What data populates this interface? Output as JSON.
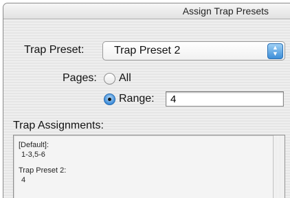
{
  "window": {
    "title": "Assign Trap Presets"
  },
  "trap_preset": {
    "label": "Trap Preset:",
    "selected": "Trap Preset 2"
  },
  "pages": {
    "label": "Pages:",
    "option_all": "All",
    "option_range": "Range:",
    "range_value": "4"
  },
  "trap_assignments": {
    "label": "Trap Assignments:",
    "entries": [
      {
        "name": "[Default]:",
        "pages": "1-3,5-6"
      },
      {
        "name": "Trap Preset 2:",
        "pages": "4"
      }
    ]
  },
  "colors": {
    "accent": "#3d8ed8"
  }
}
